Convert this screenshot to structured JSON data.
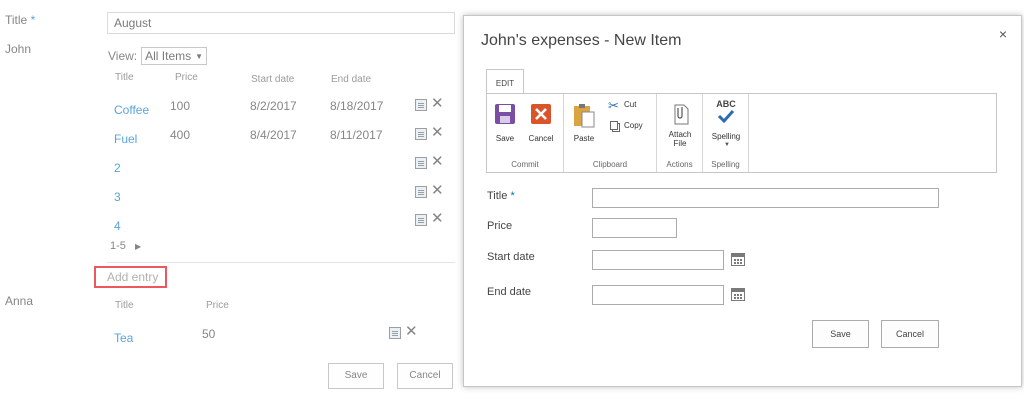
{
  "background": {
    "title_label": "Title",
    "required_mark": "*",
    "title_value": "August",
    "john_label": "John",
    "view_label": "View:",
    "view_selected": "All Items",
    "columns": {
      "title": "Title",
      "price": "Price",
      "start": "Start date",
      "end": "End date"
    },
    "john_rows": [
      {
        "title": "Coffee",
        "price": "100",
        "start": "8/2/2017",
        "end": "8/18/2017"
      },
      {
        "title": "Fuel",
        "price": "400",
        "start": "8/4/2017",
        "end": "8/11/2017"
      },
      {
        "title": "2",
        "price": "",
        "start": "",
        "end": ""
      },
      {
        "title": "3",
        "price": "",
        "start": "",
        "end": ""
      },
      {
        "title": "4",
        "price": "",
        "start": "",
        "end": ""
      }
    ],
    "pager": "1-5",
    "add_entry": "Add entry",
    "anna_label": "Anna",
    "anna_columns": {
      "title": "Title",
      "price": "Price"
    },
    "anna_rows": [
      {
        "title": "Tea",
        "price": "50"
      }
    ],
    "save": "Save",
    "cancel": "Cancel"
  },
  "dialog": {
    "title": "John's expenses - New Item",
    "close": "×",
    "ribbon_tab": "EDIT",
    "ribbon": {
      "save": "Save",
      "cancel": "Cancel",
      "paste": "Paste",
      "cut": "Cut",
      "copy": "Copy",
      "attach_line1": "Attach",
      "attach_line2": "File",
      "spelling": "Spelling",
      "abc": "ABC",
      "groups": {
        "commit": "Commit",
        "clipboard": "Clipboard",
        "actions": "Actions",
        "spelling": "Spelling"
      }
    },
    "fields": {
      "title": "Title",
      "required_mark": "*",
      "price": "Price",
      "start_date": "Start date",
      "end_date": "End date"
    },
    "save": "Save",
    "cancel": "Cancel"
  }
}
